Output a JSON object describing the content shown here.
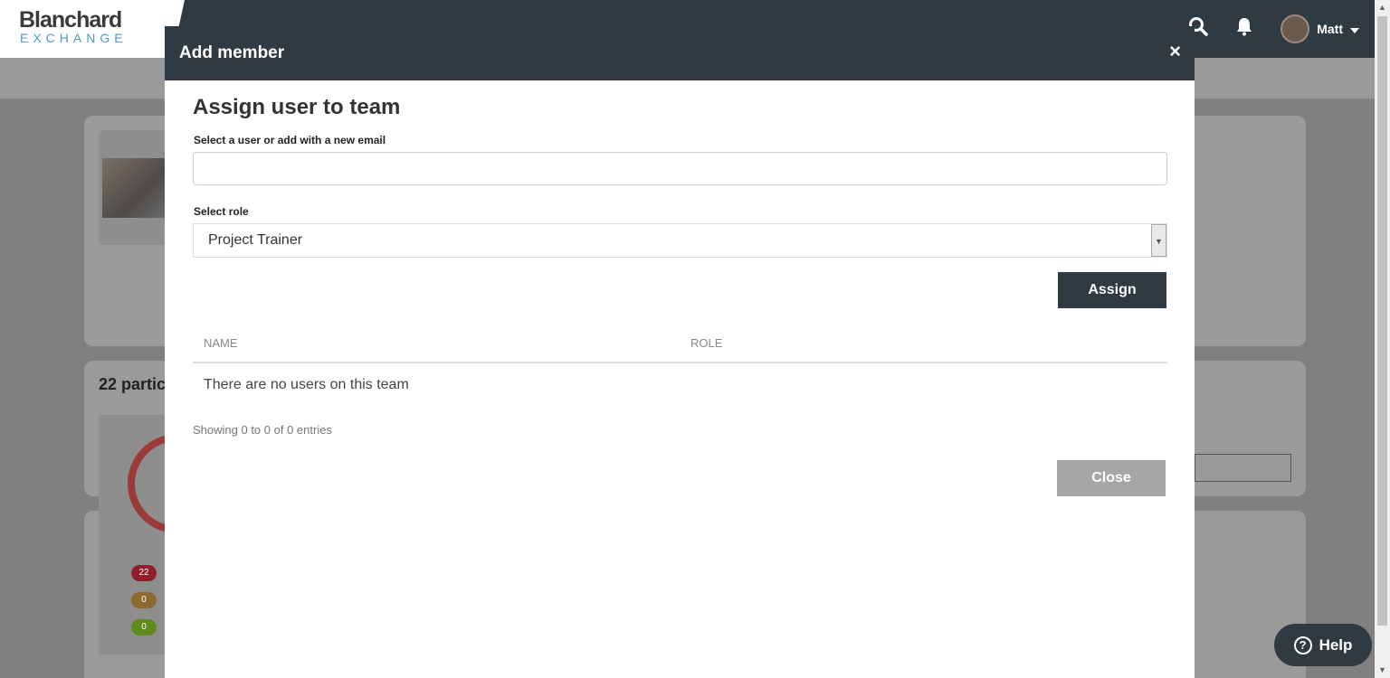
{
  "app": {
    "logo_title": "Blanchard",
    "logo_subtitle": "EXCHANGE",
    "user_name": "Matt"
  },
  "background": {
    "participants_heading": "22 partic",
    "badges": [
      "22",
      "0",
      "0"
    ]
  },
  "modal": {
    "title": "Add member",
    "close_icon": "×",
    "section_title": "Assign user to team",
    "user_field_label": "Select a user or add with a new email",
    "user_field_value": "",
    "user_field_placeholder": "",
    "role_label": "Select role",
    "role_selected": "Project Trainer",
    "assign_label": "Assign",
    "table": {
      "columns": [
        "NAME",
        "ROLE"
      ],
      "empty_message": "There are no users on this team",
      "info": "Showing 0 to 0 of 0 entries"
    },
    "close_label": "Close"
  },
  "help": {
    "label": "Help",
    "icon": "?"
  },
  "colors": {
    "header_dark": "#2f3a43",
    "logo_accent": "#4b9cc5",
    "close_button": "#a6a6a6",
    "badge_red": "#8f1f2a",
    "badge_orange": "#8c6a2e",
    "badge_green": "#5f8a1c"
  },
  "icons": [
    "search-icon",
    "bell-icon",
    "chevron-down-icon",
    "close-icon",
    "help-icon"
  ]
}
